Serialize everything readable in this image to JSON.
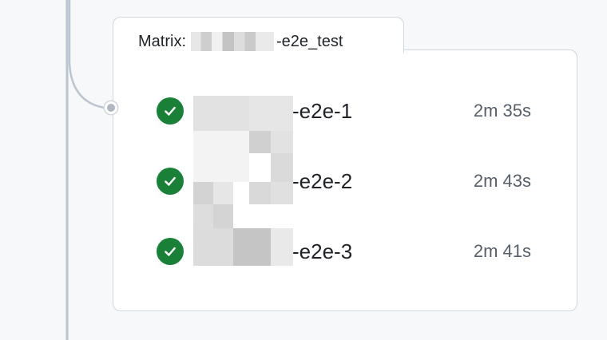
{
  "matrix": {
    "prefix": "Matrix:",
    "suffix": "-e2e_test"
  },
  "jobs": [
    {
      "name": "-e2e-1",
      "duration": "2m 35s",
      "status": "success",
      "status_icon": "check-circle-icon"
    },
    {
      "name": "-e2e-2",
      "duration": "2m 43s",
      "status": "success",
      "status_icon": "check-circle-icon"
    },
    {
      "name": "-e2e-3",
      "duration": "2m 41s",
      "status": "success",
      "status_icon": "check-circle-icon"
    }
  ],
  "colors": {
    "success": "#1a7f37",
    "border": "#d0d7de",
    "connector": "#afb8c1",
    "background": "#f6f8fa"
  }
}
